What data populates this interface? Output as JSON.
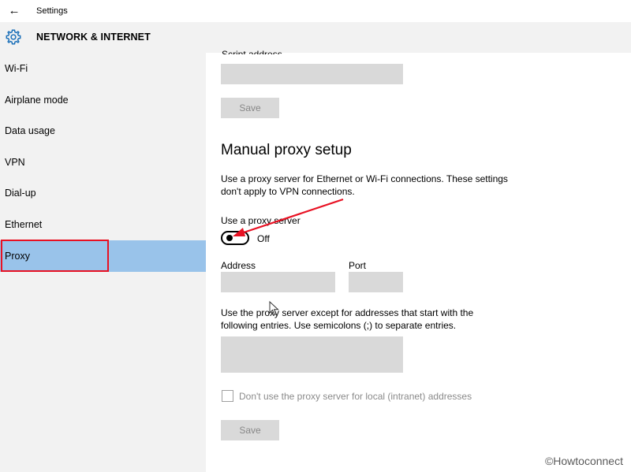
{
  "window": {
    "back_glyph": "←",
    "title": "Settings"
  },
  "header": {
    "title": "NETWORK & INTERNET",
    "icon": "gear-icon"
  },
  "sidebar": {
    "items": [
      {
        "label": "Wi-Fi"
      },
      {
        "label": "Airplane mode"
      },
      {
        "label": "Data usage"
      },
      {
        "label": "VPN"
      },
      {
        "label": "Dial-up"
      },
      {
        "label": "Ethernet"
      },
      {
        "label": "Proxy",
        "selected": true
      }
    ],
    "selected_color": "#99c3ea"
  },
  "auto_proxy": {
    "script_address_label": "Script address",
    "script_address_value": "",
    "save_label": "Save"
  },
  "manual_proxy": {
    "title": "Manual proxy setup",
    "description": "Use a proxy server for Ethernet or Wi-Fi connections. These settings don't apply to VPN connections.",
    "use_proxy_label": "Use a proxy server",
    "toggle_state": "Off",
    "address_label": "Address",
    "address_value": "",
    "port_label": "Port",
    "port_value": "",
    "exceptions_description": "Use the proxy server except for addresses that start with the following entries. Use semicolons (;) to separate entries.",
    "exceptions_value": "",
    "local_bypass_label": "Don't use the proxy server for local (intranet) addresses",
    "local_bypass_checked": false,
    "save_label": "Save"
  },
  "annotation_color": "#e81123",
  "watermark": "©Howtoconnect"
}
